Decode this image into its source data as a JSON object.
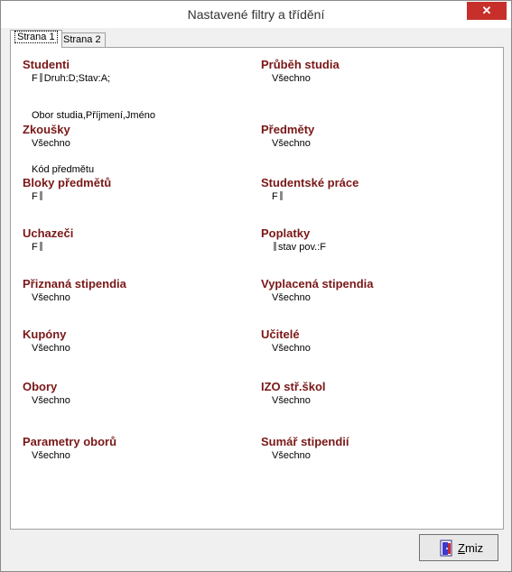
{
  "window": {
    "title": "Nastavené filtry a třídění",
    "close_glyph": "✕"
  },
  "tabs": [
    {
      "label": "Strana 1"
    },
    {
      "label": "Strana 2"
    }
  ],
  "left": [
    {
      "title": "Studenti",
      "pre": "F",
      "value": "Druh:D;Stav:A;",
      "extra": "Obor studia,Příjmení,Jméno"
    },
    {
      "title": "Zkoušky",
      "value": "Všechno",
      "extra": "Kód předmětu"
    },
    {
      "title": "Bloky předmětů",
      "pre": "F",
      "value": ""
    },
    {
      "title": "Uchazeči",
      "pre": "F",
      "value": ""
    },
    {
      "title": "Přiznaná stipendia",
      "value": "Všechno"
    },
    {
      "title": "Kupóny",
      "value": "Všechno"
    },
    {
      "title": "Obory",
      "value": "Všechno"
    },
    {
      "title": "Parametry oborů",
      "value": "Všechno"
    }
  ],
  "right": [
    {
      "title": "Průběh studia",
      "value": "Všechno"
    },
    {
      "title": "Předměty",
      "value": "Všechno"
    },
    {
      "title": "Studentské práce",
      "pre": "F",
      "value": ""
    },
    {
      "title": "Poplatky",
      "pre": "",
      "value": "stav pov.:F"
    },
    {
      "title": "Vyplacená stipendia",
      "value": "Všechno"
    },
    {
      "title": "Učitelé",
      "value": "Všechno"
    },
    {
      "title": "IZO stř.škol",
      "value": "Všechno"
    },
    {
      "title": "Sumář stipendií",
      "value": "Všechno"
    }
  ],
  "button": {
    "underlined": "Z",
    "rest": "miz",
    "icon": "door-icon"
  }
}
